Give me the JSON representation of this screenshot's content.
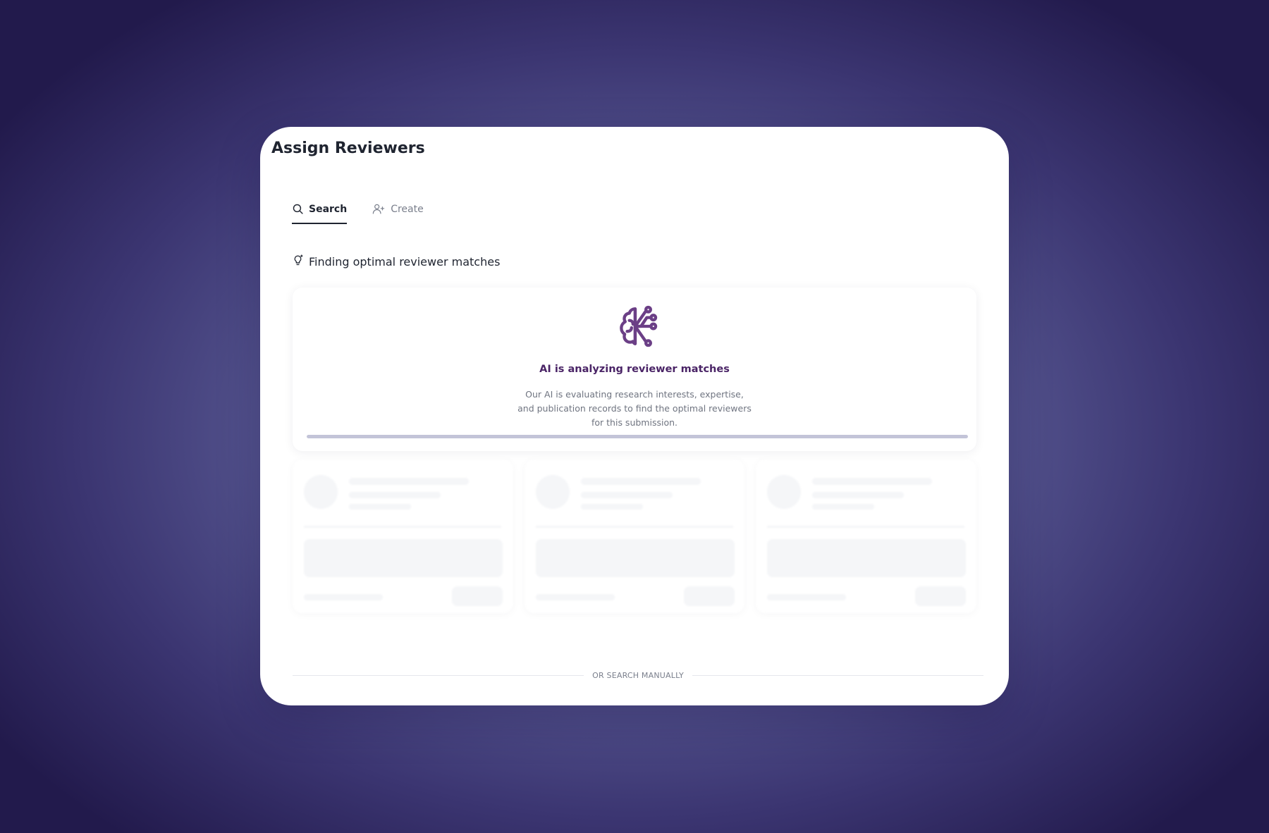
{
  "modal": {
    "title": "Assign Reviewers"
  },
  "tabs": [
    {
      "label": "Search",
      "icon": "search-icon",
      "active": true
    },
    {
      "label": "Create",
      "icon": "user-plus-icon",
      "active": false
    }
  ],
  "section": {
    "heading": "Finding optimal reviewer matches",
    "icon": "lightbulb-sparkle-icon"
  },
  "ai_card": {
    "icon": "ai-brain-circuit-icon",
    "title": "AI is analyzing reviewer matches",
    "description": "Our AI is evaluating research interests, expertise, and publication records to find the optimal reviewers for this submission.",
    "progress_percent": 100
  },
  "colors": {
    "accent": "#4a2466",
    "icon": "#6b3f86"
  },
  "placeholder_cards_count": 3,
  "divider": {
    "label": "OR SEARCH MANUALLY"
  }
}
